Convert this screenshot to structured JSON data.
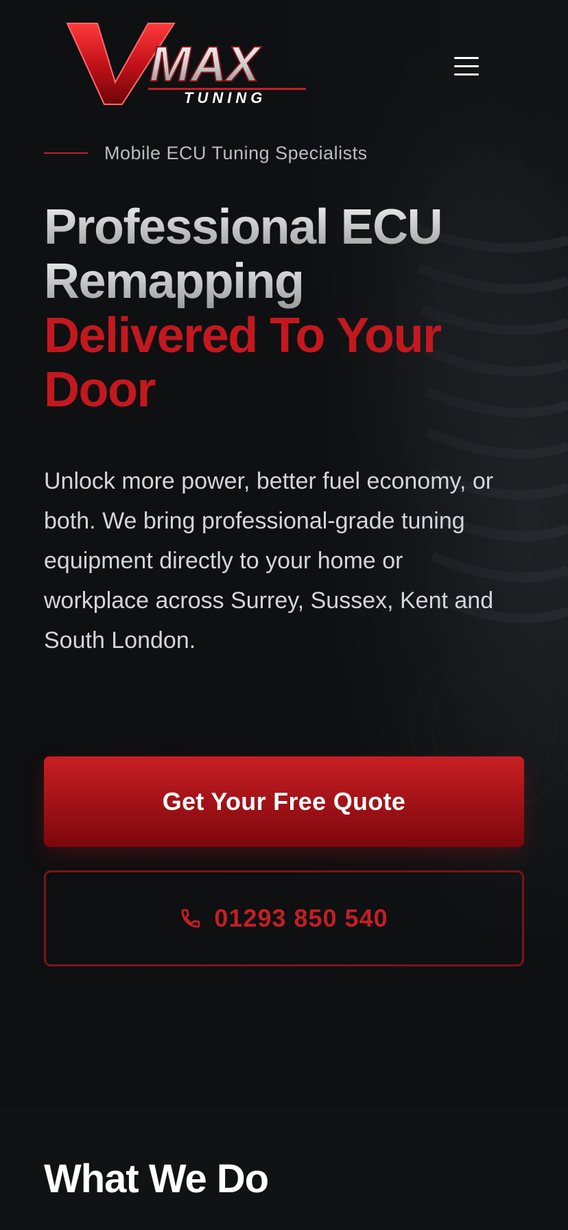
{
  "brand": {
    "logo_main": "MAX",
    "logo_sub": "TUNING",
    "logo_initial": "V"
  },
  "header": {
    "menu_icon": "hamburger-menu-icon"
  },
  "hero": {
    "tagline": "Mobile ECU Tuning Specialists",
    "headline_line1": "Professional ECU",
    "headline_line2": "Remapping",
    "headline_line3": "Delivered To Your",
    "headline_line4": "Door",
    "intro": "Unlock more power, better fuel economy, or both. We bring professional-grade tuning equipment directly to your home or workplace across Surrey, Sussex, Kent and South London.",
    "cta_primary": "Get Your Free Quote",
    "cta_phone": "01293 850 540",
    "phone_icon": "phone-icon"
  },
  "section": {
    "title": "What We Do"
  },
  "colors": {
    "accent_red": "#c41e24",
    "background": "#0f1113",
    "text_muted": "#b9bec6"
  }
}
